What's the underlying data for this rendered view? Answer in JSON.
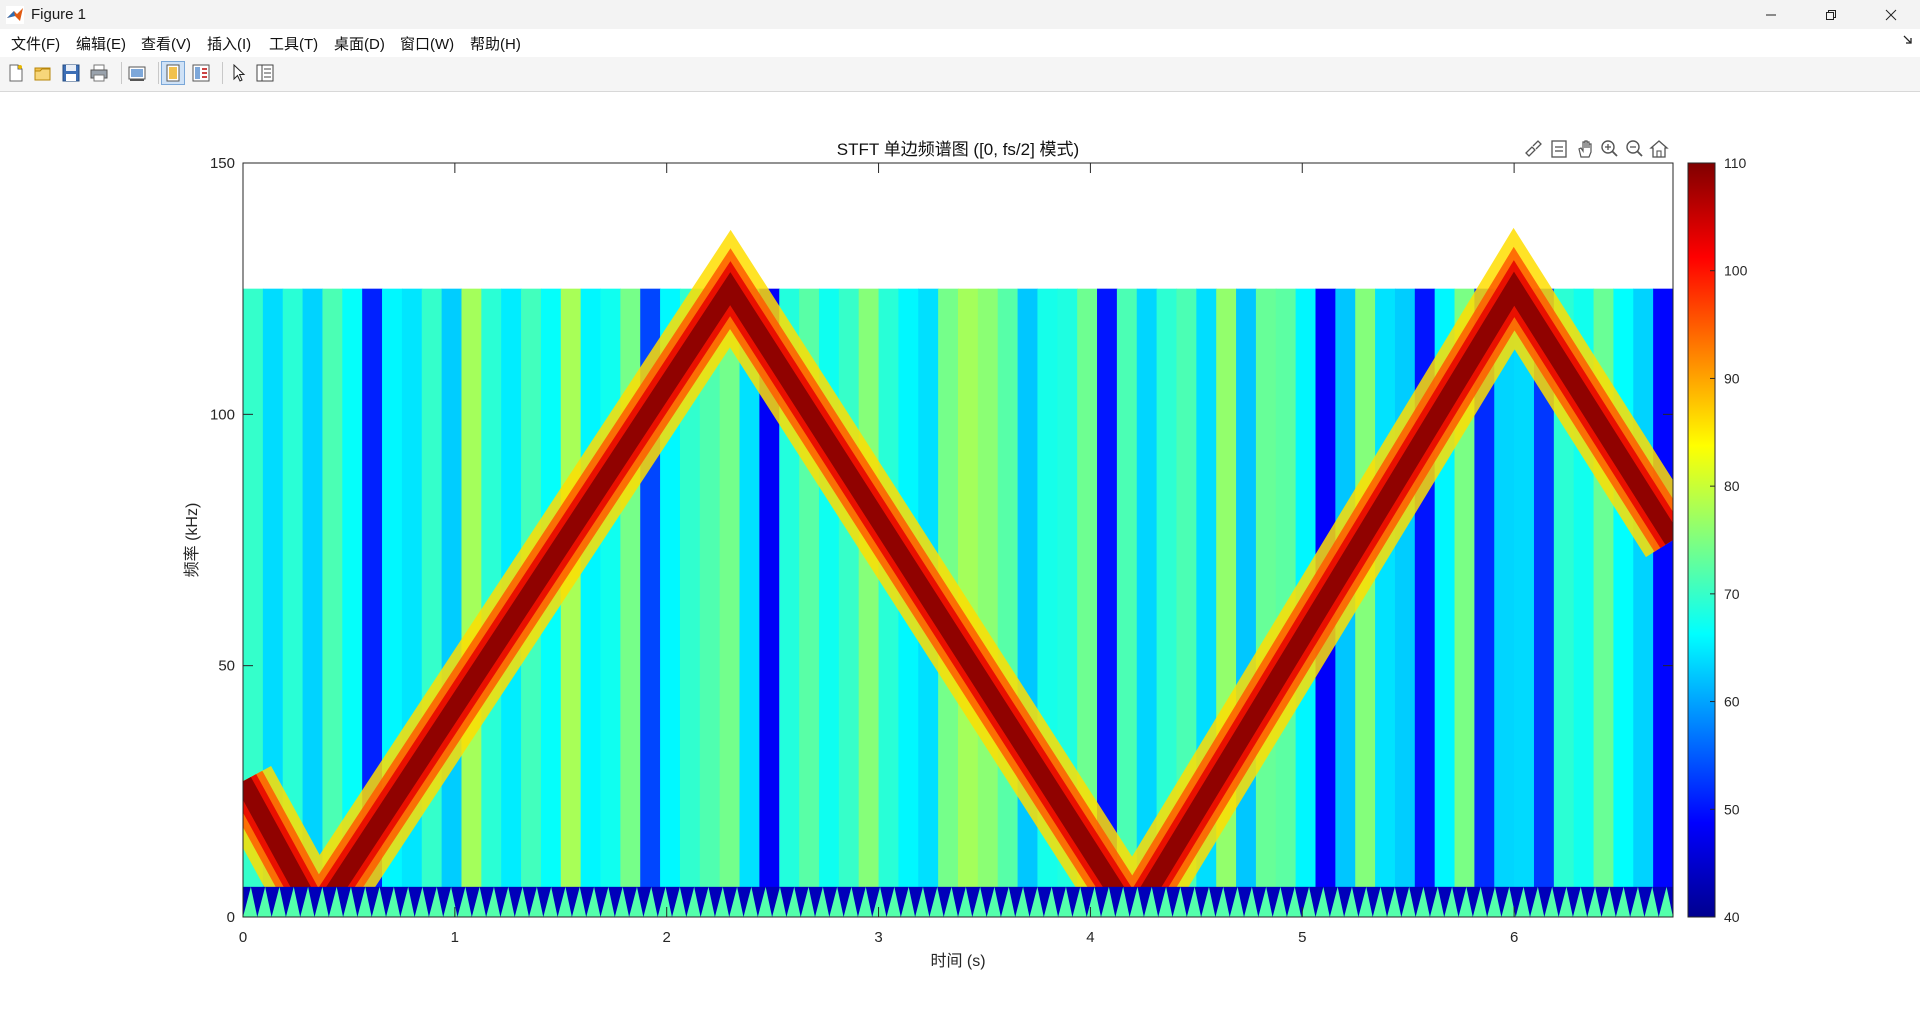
{
  "window": {
    "title": "Figure 1",
    "controls": [
      "minimize",
      "restore",
      "close"
    ]
  },
  "menu": {
    "items": [
      {
        "label": "文件(F)"
      },
      {
        "label": "编辑(E)"
      },
      {
        "label": "查看(V)"
      },
      {
        "label": "插入(I)"
      },
      {
        "label": "工具(T)"
      },
      {
        "label": "桌面(D)"
      },
      {
        "label": "窗口(W)"
      },
      {
        "label": "帮助(H)"
      }
    ]
  },
  "toolbar": {
    "buttons": [
      "new-figure-icon",
      "open-file-icon",
      "save-icon",
      "print-icon",
      "link-plot-icon",
      "hide-plot-tools-icon",
      "show-plot-tools-icon",
      "edit-plot-arrow-icon",
      "property-inspector-icon"
    ]
  },
  "axes_toolbar": {
    "buttons": [
      "brush-icon",
      "data-tip-icon",
      "pan-hand-icon",
      "zoom-in-icon",
      "zoom-out-icon",
      "home-icon"
    ]
  },
  "chart_data": {
    "type": "heatmap",
    "title": "STFT 单边频谱图 ([0, fs/2] 模式)",
    "xlabel": "时间 (s)",
    "ylabel": "频率 (kHz)",
    "xlim": [
      0,
      6.75
    ],
    "ylim": [
      0,
      150
    ],
    "xticks": [
      0,
      1,
      2,
      3,
      4,
      5,
      6
    ],
    "yticks": [
      0,
      50,
      100,
      150
    ],
    "data_extent": {
      "x": [
        0,
        6.75
      ],
      "y": [
        0,
        125
      ]
    },
    "colorbar": {
      "ticks": [
        40,
        50,
        60,
        70,
        80,
        90,
        100,
        110
      ],
      "clim": [
        40,
        110
      ],
      "colormap": "jet"
    },
    "ridge": {
      "description_units": "time s, frequency kHz",
      "t": [
        0,
        0.35,
        2.3,
        4.2,
        6.0,
        6.75
      ],
      "f": [
        27,
        0,
        125,
        0,
        125,
        75
      ]
    },
    "background_level_db": [
      62,
      78
    ]
  }
}
